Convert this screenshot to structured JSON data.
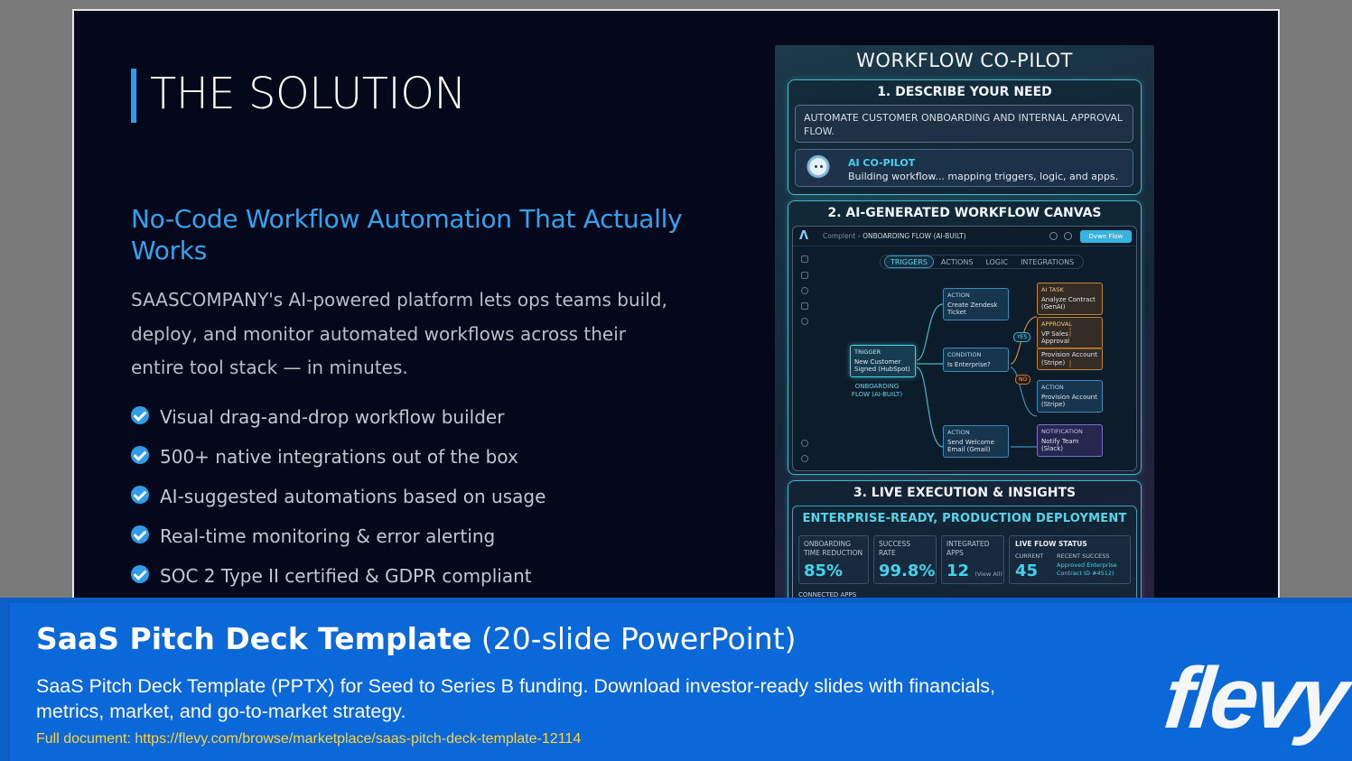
{
  "slide": {
    "title": "THE SOLUTION",
    "subtitle": "No-Code Workflow Automation That Actually Works",
    "body": "SAASCOMPANY's AI-powered platform lets ops teams build, deploy, and monitor automated workflows across their entire tool stack — in minutes.",
    "features": [
      "Visual drag-and-drop workflow builder",
      "500+ native integrations out of the box",
      "AI-suggested automations based on usage",
      "Real-time monitoring & error alerting",
      "SOC 2 Type II certified & GDPR compliant"
    ]
  },
  "mockup": {
    "title": "WORKFLOW CO-PILOT",
    "step1": {
      "heading": "1. DESCRIBE YOUR NEED",
      "need": "AUTOMATE CUSTOMER ONBOARDING AND INTERNAL APPROVAL FLOW.",
      "ai_name": "AI CO-PILOT",
      "ai_message": "Building workflow... mapping triggers, logic, and apps."
    },
    "step2": {
      "heading": "2. AI-GENERATED WORKFLOW CANVAS",
      "breadcrumb_root": "Complent",
      "breadcrumb_page": "ONBOARDING FLOW (AI-BUILT)",
      "deploy_label": "Dvwe Flow",
      "tabs": [
        "TRIGGERS",
        "ACTIONS",
        "LOGIC",
        "INTEGRATIONS"
      ],
      "flow_label": "ONBOARDING FLOW (AI-BUILT)",
      "yes_label": "YES",
      "no_label": "NO",
      "nodes": {
        "trigger": {
          "kind": "TRIGGER",
          "text": "New Customer Signed (HubSpot)"
        },
        "action_zendesk": {
          "kind": "ACTION",
          "text": "Create Zendesk Ticket"
        },
        "condition": {
          "kind": "CONDITION",
          "text": "Is Enterprise?"
        },
        "action_welcome": {
          "kind": "ACTION",
          "text": "Send Welcome Email (Gmail)"
        },
        "ai_task": {
          "kind": "AI TASK",
          "text": "Analyze Contract (GenAI)"
        },
        "approval": {
          "kind": "APPROVAL",
          "text": "VP Sales Approval"
        },
        "provision_yes": {
          "kind": "",
          "text": "Provision Account (Stripe)"
        },
        "action_provision": {
          "kind": "ACTION",
          "text": "Provision Account (Stripe)"
        },
        "notification": {
          "kind": "NOTIFICATION",
          "text": "Notify Team (Slack)"
        }
      }
    },
    "step3": {
      "heading": "3. LIVE EXECUTION & INSIGHTS",
      "banner": "ENTERPRISE-READY, PRODUCTION DEPLOYMENT",
      "metrics": [
        {
          "label": "ONBOARDING TIME REDUCTION",
          "value": "85%"
        },
        {
          "label": "SUCCESS RATE",
          "value": "99.8%"
        },
        {
          "label": "INTEGRATED APPS",
          "value": "12",
          "note": "(View All)"
        }
      ],
      "live": {
        "title": "LIVE FLOW STATUS",
        "current_label": "CURRENT",
        "recent_label": "RECENT SUCCESS",
        "current_value": "45",
        "recent_value": "Approved Enterprise Contract ID #4512)"
      },
      "connected": "CONNECTED APPS"
    }
  },
  "footer": {
    "title_bold": "SaaS Pitch Deck Template",
    "title_light": "(20-slide PowerPoint)",
    "description": "SaaS Pitch Deck Template (PPTX) for Seed to Series B funding. Download investor-ready slides with financials, metrics, market, and go-to-market strategy.",
    "link": "Full document: https://flevy.com/browse/marketplace/saas-pitch-deck-template-12114",
    "brand": "flevy"
  },
  "colors": {
    "accent": "#2f9ce8",
    "slide_bg": "#05081a",
    "footer_bg": "#0a68d9",
    "link": "#ffd23f",
    "teal": "#44d2ea"
  }
}
